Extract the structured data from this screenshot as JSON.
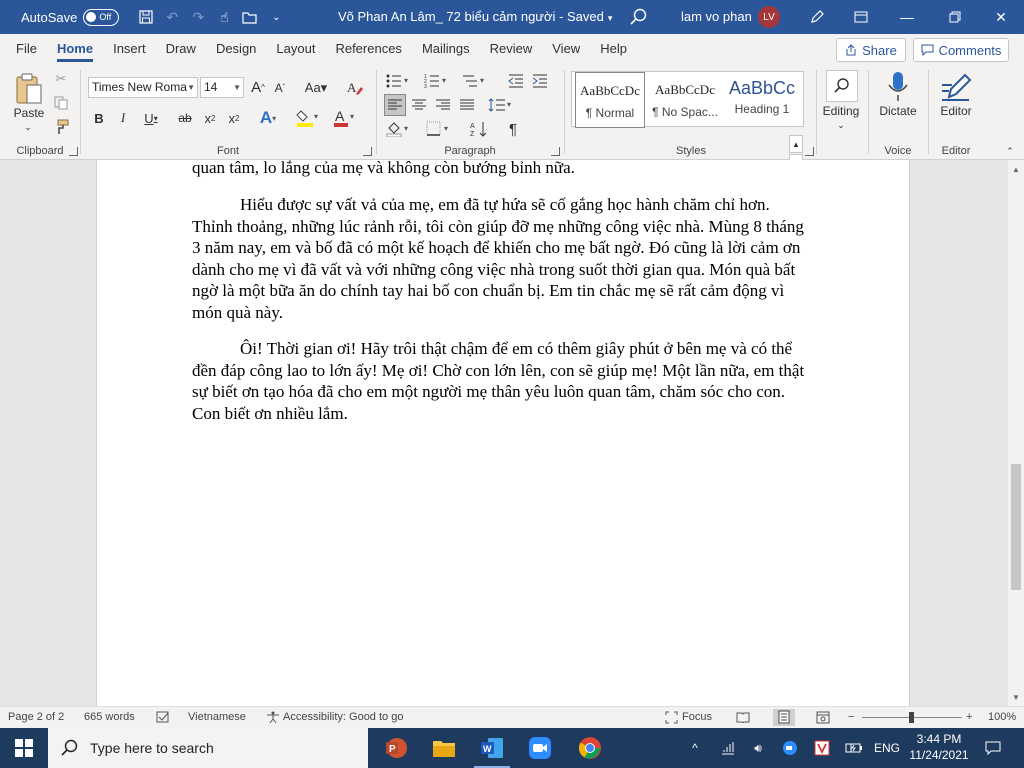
{
  "titlebar": {
    "autosave_label": "AutoSave",
    "autosave_state": "Off",
    "document_title": "Võ Phan An Lâm_ 72 biểu cảm người",
    "save_status": "Saved",
    "user_name": "lam vo phan",
    "user_initials": "LV"
  },
  "tabs": [
    "File",
    "Home",
    "Insert",
    "Draw",
    "Design",
    "Layout",
    "References",
    "Mailings",
    "Review",
    "View",
    "Help"
  ],
  "active_tab": "Home",
  "actions": {
    "share": "Share",
    "comments": "Comments"
  },
  "ribbon": {
    "clipboard": {
      "label": "Clipboard",
      "paste": "Paste"
    },
    "font": {
      "label": "Font",
      "font_name": "Times New Roma",
      "font_size": "14"
    },
    "paragraph": {
      "label": "Paragraph"
    },
    "styles": {
      "label": "Styles",
      "items": [
        {
          "preview": "AaBbCcDc",
          "name": "¶ Normal"
        },
        {
          "preview": "AaBbCcDc",
          "name": "¶ No Spac..."
        },
        {
          "preview": "AaBbCc",
          "name": "Heading 1"
        }
      ]
    },
    "editing": {
      "label": "Editing"
    },
    "voice": {
      "label": "Voice",
      "dictate": "Dictate"
    },
    "editor": {
      "label": "Editor",
      "editor_btn": "Editor"
    }
  },
  "document": {
    "partial_line": "quan tâm, lo lắng của mẹ và không còn bướng bỉnh nữa.",
    "paragraphs": [
      "Hiểu được sự vất vả của mẹ, em đã tự hứa sẽ cố gắng học hành chăm chỉ hơn. Thỉnh thoảng, những lúc rảnh rỗi, tôi còn giúp đỡ mẹ những công việc nhà. Mùng 8 tháng 3 năm nay, em  và bố đã có một kế hoạch để khiến cho mẹ bất ngờ. Đó cũng là lời cảm ơn dành cho mẹ vì đã vất và với những công việc nhà trong suốt thời gian qua. Món quà bất ngờ là một bữa ăn do chính tay hai bố con chuẩn bị. Em tin chắc mẹ sẽ rất cảm động vì món quà này.",
      "Ôi! Thời gian ơi! Hãy trôi thật chậm để em có thêm giây phút ở bên mẹ và có thể đền đáp công lao to lớn ấy! Mẹ ơi! Chờ con lớn lên, con sẽ giúp mẹ! Một lần nữa, em thật sự biết ơn tạo hóa đã cho em một người mẹ thân yêu luôn quan tâm, chăm sóc cho con. Con biết ơn nhiều lắm."
    ]
  },
  "statusbar": {
    "page": "Page 2 of 2",
    "words": "665 words",
    "language": "Vietnamese",
    "accessibility": "Accessibility: Good to go",
    "focus": "Focus",
    "zoom": "100%"
  },
  "taskbar": {
    "search_placeholder": "Type here to search",
    "language": "ENG",
    "time": "3:44 PM",
    "date": "11/24/2021"
  }
}
